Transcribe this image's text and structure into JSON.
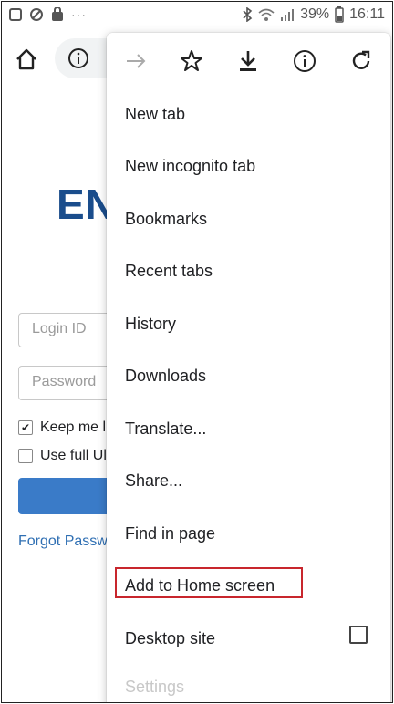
{
  "status_bar": {
    "battery": "39%",
    "time": "16:11",
    "more": "···",
    "icons": [
      "image-icon",
      "blocked-icon",
      "bag-icon",
      "bluetooth-icon",
      "wifi-icon",
      "signal-icon",
      "battery-icon"
    ]
  },
  "toolbar": {
    "icons": [
      "home-icon",
      "info-icon"
    ]
  },
  "page": {
    "logo_text": "EN",
    "login_placeholder": "Login ID",
    "password_placeholder": "Password",
    "keep_me": "Keep me l",
    "use_full": "Use full Ul",
    "forgot": "Forgot Passw"
  },
  "menu": {
    "top_icons": [
      "forward-icon",
      "star-icon",
      "download-icon",
      "info-icon",
      "refresh-icon"
    ],
    "items": [
      {
        "label": "New tab"
      },
      {
        "label": "New incognito tab"
      },
      {
        "label": "Bookmarks"
      },
      {
        "label": "Recent tabs"
      },
      {
        "label": "History"
      },
      {
        "label": "Downloads"
      },
      {
        "label": "Translate..."
      },
      {
        "label": "Share..."
      },
      {
        "label": "Find in page"
      },
      {
        "label": "Add to Home screen"
      },
      {
        "label": "Desktop site"
      }
    ],
    "cut_item": "Settings"
  },
  "colors": {
    "highlight": "#c8262d",
    "brand_blue": "#1a4d8c",
    "link_blue": "#2f6fb3"
  }
}
